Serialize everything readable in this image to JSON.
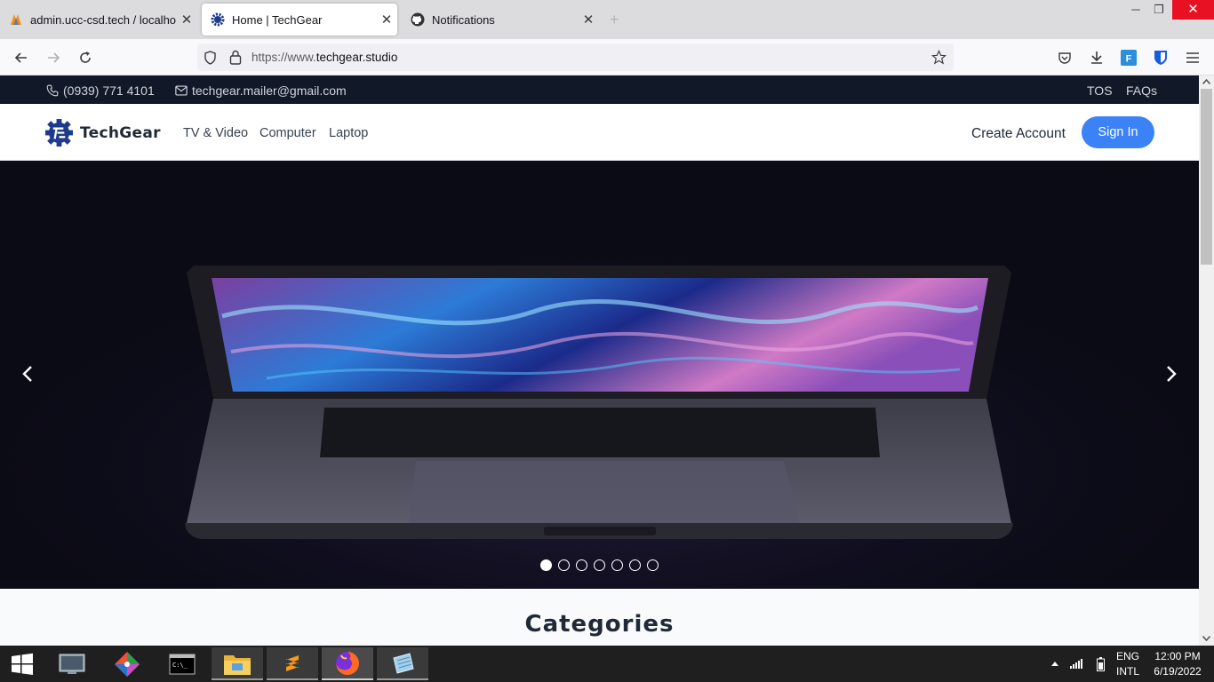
{
  "browser": {
    "tabs": [
      {
        "title": "admin.ucc-csd.tech / localhost",
        "active": false
      },
      {
        "title": "Home | TechGear",
        "active": true
      },
      {
        "title": "Notifications",
        "active": false
      }
    ],
    "url_prefix": "https://www.",
    "url_domain": "techgear.studio"
  },
  "site": {
    "phone": "(0939) 771 4101",
    "email": "techgear.mailer@gmail.com",
    "top_links": [
      "TOS",
      "FAQs"
    ],
    "brand": "TechGear",
    "nav": [
      "TV & Video",
      "Computer",
      "Laptop"
    ],
    "create_account": "Create Account",
    "sign_in": "Sign In",
    "carousel": {
      "slide_count": 7,
      "active_slide": 1
    },
    "section_title": "Categories"
  },
  "taskbar": {
    "lang1": "ENG",
    "lang2": "INTL",
    "time": "12:00 PM",
    "date": "6/19/2022"
  },
  "colors": {
    "accent": "#3b82f6",
    "topbar": "#111827",
    "hero_bg": "#0b0b16",
    "close_red": "#e81123"
  }
}
